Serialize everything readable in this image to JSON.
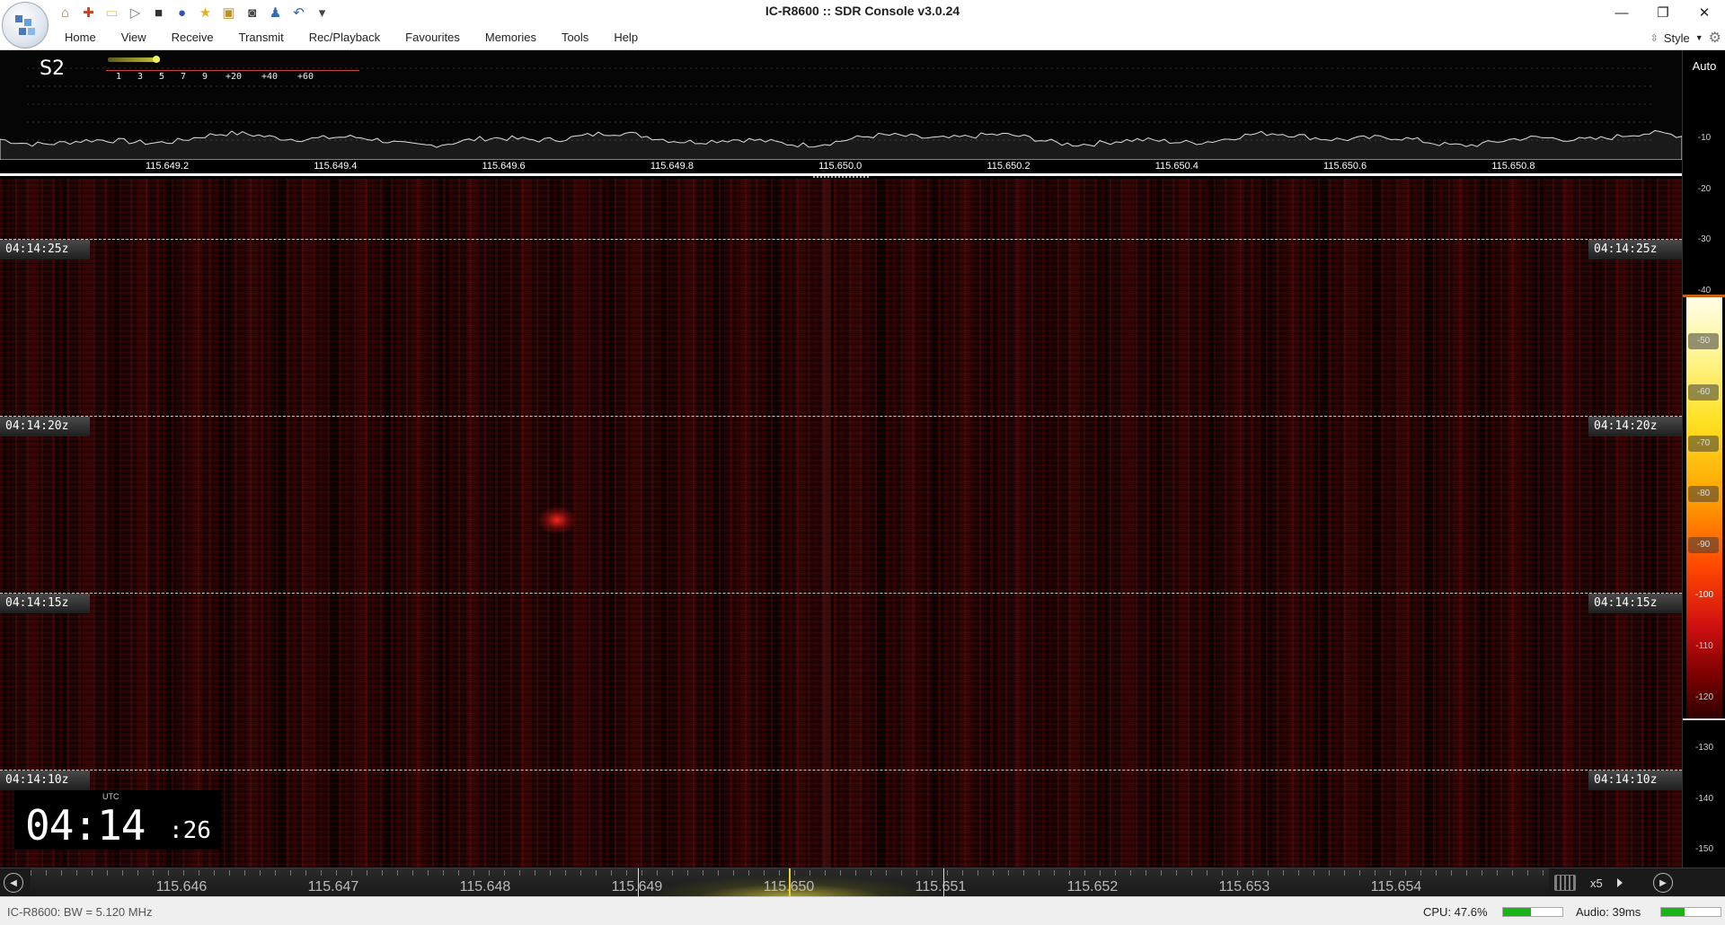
{
  "window": {
    "title": "IC-R8600 :: SDR Console v3.0.24",
    "controls": [
      "minimize",
      "restore",
      "close"
    ]
  },
  "quick_toolbar": [
    {
      "icon": "home-icon",
      "glyph": "⌂"
    },
    {
      "icon": "lifebuoy-icon",
      "glyph": "✚"
    },
    {
      "icon": "folder-icon",
      "glyph": "▭"
    },
    {
      "icon": "play-icon",
      "glyph": "▷"
    },
    {
      "icon": "stop-icon",
      "glyph": "■"
    },
    {
      "icon": "record-icon",
      "glyph": "●"
    },
    {
      "icon": "star-icon",
      "glyph": "★"
    },
    {
      "icon": "lock-icon",
      "glyph": "▣"
    },
    {
      "icon": "camera-icon",
      "glyph": "◙"
    },
    {
      "icon": "person-icon",
      "glyph": "♟"
    },
    {
      "icon": "undo-icon",
      "glyph": "↶"
    },
    {
      "icon": "customize-dropdown-icon",
      "glyph": "▾"
    }
  ],
  "ribbon": {
    "tabs": [
      "Home",
      "View",
      "Receive",
      "Transmit",
      "Rec/Playback",
      "Favourites",
      "Memories",
      "Tools",
      "Help"
    ],
    "style_label": "Style"
  },
  "smeter": {
    "label": "S2",
    "scale": [
      "1",
      "3",
      "5",
      "7",
      "9",
      "+20",
      "+40",
      "+60"
    ]
  },
  "spectrum": {
    "frequency_labels": [
      "115.649.2",
      "115.649.4",
      "115.649.6",
      "115.649.8",
      "115.650.0",
      "115.650.2",
      "115.650.4",
      "115.650.6",
      "115.650.8"
    ]
  },
  "level_scale": {
    "auto_label": "Auto",
    "values": [
      "-10",
      "-20",
      "-30",
      "-40",
      "-50",
      "-60",
      "-70",
      "-80",
      "-90",
      "-100",
      "-110",
      "-120",
      "-130",
      "-140",
      "-150"
    ]
  },
  "waterfall": {
    "timestamps": [
      "04:14:25z",
      "04:14:20z",
      "04:14:15z",
      "04:14:10z"
    ]
  },
  "clock": {
    "zone": "UTC",
    "hours_minutes": "04:14",
    "seconds": ":26"
  },
  "band_scroller": {
    "labels": [
      "115.646",
      "115.647",
      "115.648",
      "115.649",
      "115.650",
      "115.651",
      "115.652",
      "115.653",
      "115.654"
    ],
    "zoom": "x5"
  },
  "statusbar": {
    "radio_info": "IC-R8600: BW = 5.120 MHz",
    "cpu_label": "CPU: 47.6%",
    "cpu_level": 0.476,
    "audio_label": "Audio: 39ms",
    "audio_level": 0.4
  },
  "colors": {
    "accent": "#18b418",
    "marker": "#e8d030",
    "waterfall_base": "#1a0606"
  }
}
